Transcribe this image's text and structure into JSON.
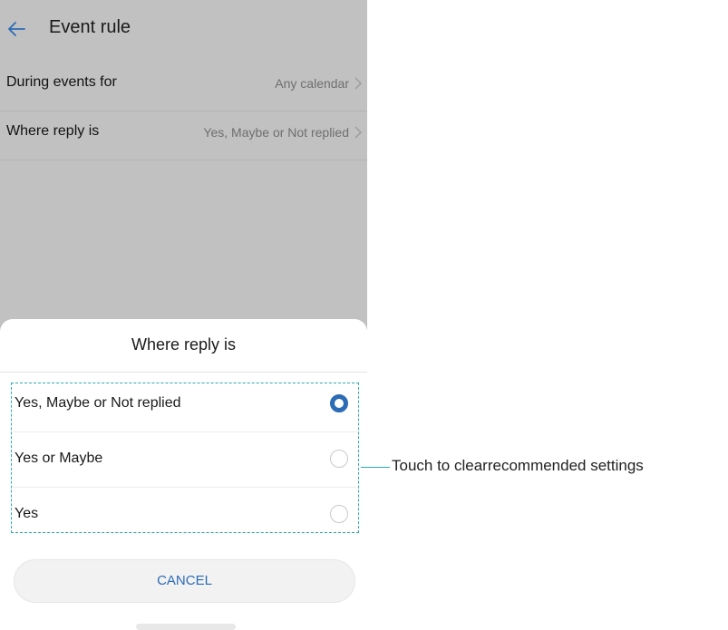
{
  "appbar": {
    "title": "Event rule",
    "back_icon": "arrow-left-icon",
    "accent": "#2c6bb5"
  },
  "settings": {
    "rows": [
      {
        "label": "During events for",
        "value": "Any calendar"
      },
      {
        "label": "Where reply is",
        "value": "Yes, Maybe or Not replied"
      }
    ]
  },
  "sheet": {
    "title": "Where reply is",
    "options": [
      {
        "label": "Yes, Maybe or Not replied",
        "selected": true
      },
      {
        "label": "Yes or Maybe",
        "selected": false
      },
      {
        "label": "Yes",
        "selected": false
      }
    ],
    "cancel_label": "CANCEL"
  },
  "annotation": {
    "text": "Touch to clearrecommended settings",
    "color": "#2aaab0"
  }
}
